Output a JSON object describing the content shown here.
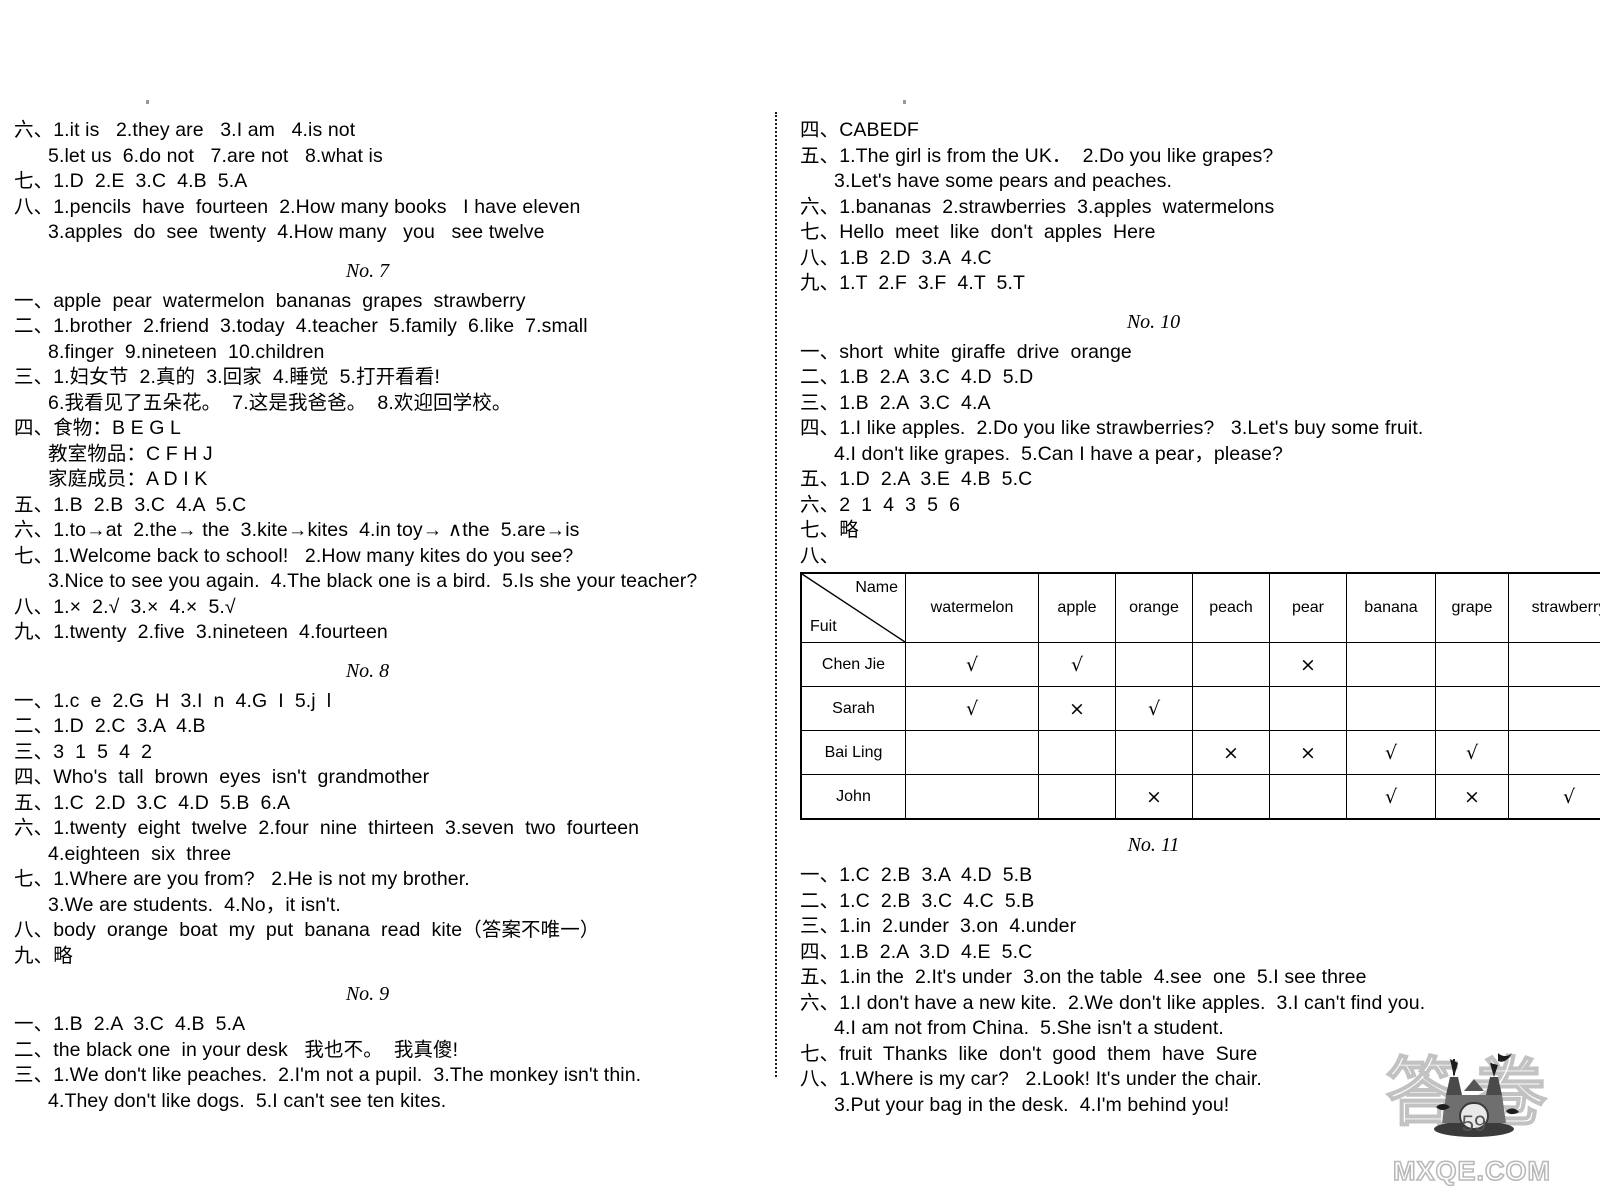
{
  "page": {
    "page_number": "59",
    "watermark_text": "MXQE.COM",
    "watermark_cn": "答卷"
  },
  "left_column": {
    "blocks": [
      {
        "id": "no6-tail",
        "lines": [
          {
            "text": "六、1.it is   2.they are   3.I am   4.is not",
            "indent": false
          },
          {
            "text": "5.let us  6.do not   7.are not   8.what is",
            "indent": true
          },
          {
            "text": "七、1.D  2.E  3.C  4.B  5.A",
            "indent": false
          },
          {
            "text": "八、1.pencils  have  fourteen  2.How many books   I have eleven",
            "indent": false
          },
          {
            "text": "3.apples  do  see  twenty  4.How many   you   see twelve",
            "indent": true
          }
        ]
      },
      {
        "id": "no7",
        "header": "No. 7",
        "lines": [
          {
            "text": "一、apple  pear  watermelon  bananas  grapes  strawberry",
            "indent": false
          },
          {
            "text": "二、1.brother  2.friend  3.today  4.teacher  5.family  6.like  7.small",
            "indent": false
          },
          {
            "text": "8.finger  9.nineteen  10.children",
            "indent": true
          },
          {
            "text": "三、1.妇女节  2.真的  3.回家  4.睡觉  5.打开看看!",
            "indent": false
          },
          {
            "text": "6.我看见了五朵花。  7.这是我爸爸。  8.欢迎回学校。",
            "indent": true
          },
          {
            "text": "四、食物：B E G L",
            "indent": false
          },
          {
            "text": "教室物品：C F H J",
            "indent": true
          },
          {
            "text": "家庭成员：A D I K",
            "indent": true
          },
          {
            "text": "五、1.B  2.B  3.C  4.A  5.C",
            "indent": false
          },
          {
            "text": "六、1.to→at  2.the→ the  3.kite→kites  4.in toy→ ∧the  5.are→is",
            "indent": false
          },
          {
            "text": "七、1.Welcome back to school!   2.How many kites do you see?",
            "indent": false
          },
          {
            "text": "3.Nice to see you again.  4.The black one is a bird.  5.Is she your teacher?",
            "indent": true
          },
          {
            "text": "八、1.×  2.√  3.×  4.×  5.√",
            "indent": false
          },
          {
            "text": "九、1.twenty  2.five  3.nineteen  4.fourteen",
            "indent": false
          }
        ]
      },
      {
        "id": "no8",
        "header": "No. 8",
        "lines": [
          {
            "text": "一、1.c  e  2.G  H  3.I  n  4.G  I  5.j  l",
            "indent": false
          },
          {
            "text": "二、1.D  2.C  3.A  4.B",
            "indent": false
          },
          {
            "text": "三、3  1  5  4  2",
            "indent": false
          },
          {
            "text": "四、Who's  tall  brown  eyes  isn't  grandmother",
            "indent": false
          },
          {
            "text": "五、1.C  2.D  3.C  4.D  5.B  6.A",
            "indent": false
          },
          {
            "text": "六、1.twenty  eight  twelve  2.four  nine  thirteen  3.seven  two  fourteen",
            "indent": false
          },
          {
            "text": "4.eighteen  six  three",
            "indent": true
          },
          {
            "text": "七、1.Where are you from?   2.He is not my brother.",
            "indent": false
          },
          {
            "text": "3.We are students.  4.No，it isn't.",
            "indent": true
          },
          {
            "text": "八、body  orange  boat  my  put  banana  read  kite（答案不唯一）",
            "indent": false
          },
          {
            "text": "九、略",
            "indent": false
          }
        ]
      },
      {
        "id": "no9",
        "header": "No. 9",
        "lines": [
          {
            "text": "一、1.B  2.A  3.C  4.B  5.A",
            "indent": false
          },
          {
            "text": "二、the black one  in your desk   我也不。  我真傻!",
            "indent": false
          },
          {
            "text": "三、1.We don't like peaches.  2.I'm not a pupil.  3.The monkey isn't thin.",
            "indent": false
          },
          {
            "text": "4.They don't like dogs.  5.I can't see ten kites.",
            "indent": true
          }
        ]
      }
    ]
  },
  "right_column": {
    "blocks": [
      {
        "id": "no9-tail",
        "lines": [
          {
            "text": "四、CABEDF",
            "indent": false
          },
          {
            "text": "五、1.The girl is from the UK．  2.Do you like grapes?",
            "indent": false
          },
          {
            "text": "3.Let's have some pears and peaches.",
            "indent": true
          },
          {
            "text": "六、1.bananas  2.strawberries  3.apples  watermelons",
            "indent": false
          },
          {
            "text": "七、Hello  meet  like  don't  apples  Here",
            "indent": false
          },
          {
            "text": "八、1.B  2.D  3.A  4.C",
            "indent": false
          },
          {
            "text": "九、1.T  2.F  3.F  4.T  5.T",
            "indent": false
          }
        ]
      },
      {
        "id": "no10",
        "header": "No. 10",
        "lines": [
          {
            "text": "一、short  white  giraffe  drive  orange",
            "indent": false
          },
          {
            "text": "二、1.B  2.A  3.C  4.D  5.D",
            "indent": false
          },
          {
            "text": "三、1.B  2.A  3.C  4.A",
            "indent": false
          },
          {
            "text": "四、1.I like apples.  2.Do you like strawberries?   3.Let's buy some fruit.",
            "indent": false
          },
          {
            "text": "4.I don't like grapes.  5.Can I have a pear，please?",
            "indent": true
          },
          {
            "text": "五、1.D  2.A  3.E  4.B  5.C",
            "indent": false
          },
          {
            "text": "六、2  1  4  3  5  6",
            "indent": false
          },
          {
            "text": "七、略",
            "indent": false
          },
          {
            "text": "八、",
            "indent": false
          }
        ]
      },
      {
        "id": "no11",
        "header": "No. 11",
        "lines": [
          {
            "text": "一、1.C  2.B  3.A  4.D  5.B",
            "indent": false
          },
          {
            "text": "二、1.C  2.B  3.C  4.C  5.B",
            "indent": false
          },
          {
            "text": "三、1.in  2.under  3.on  4.under",
            "indent": false
          },
          {
            "text": "四、1.B  2.A  3.D  4.E  5.C",
            "indent": false
          },
          {
            "text": "五、1.in the  2.It's under  3.on the table  4.see  one  5.I see three",
            "indent": false
          },
          {
            "text": "六、1.I don't have a new kite.  2.We don't like apples.  3.I can't find you.",
            "indent": false
          },
          {
            "text": "4.I am not from China.  5.She isn't a student.",
            "indent": true
          },
          {
            "text": "七、fruit  Thanks  like  don't  good  them  have  Sure",
            "indent": false
          },
          {
            "text": "八、1.Where is my car?   2.Look! It's under the chair.",
            "indent": false
          },
          {
            "text": "3.Put your bag in the desk.  4.I'm behind you!",
            "indent": true
          }
        ]
      }
    ]
  },
  "fruit_table": {
    "corner_top_label": "Name",
    "corner_bottom_label": "Fuit",
    "columns": [
      "watermelon",
      "apple",
      "orange",
      "peach",
      "pear",
      "banana",
      "grape",
      "strawberry"
    ],
    "rows": [
      {
        "name": "Chen Jie",
        "cells": [
          "√",
          "√",
          "",
          "",
          "×",
          "",
          "",
          ""
        ]
      },
      {
        "name": "Sarah",
        "cells": [
          "√",
          "×",
          "√",
          "",
          "",
          "",
          "",
          ""
        ]
      },
      {
        "name": "Bai Ling",
        "cells": [
          "",
          "",
          "",
          "×",
          "×",
          "√",
          "√",
          ""
        ]
      },
      {
        "name": "John",
        "cells": [
          "",
          "",
          "×",
          "",
          "",
          "√",
          "×",
          "√"
        ]
      }
    ]
  }
}
